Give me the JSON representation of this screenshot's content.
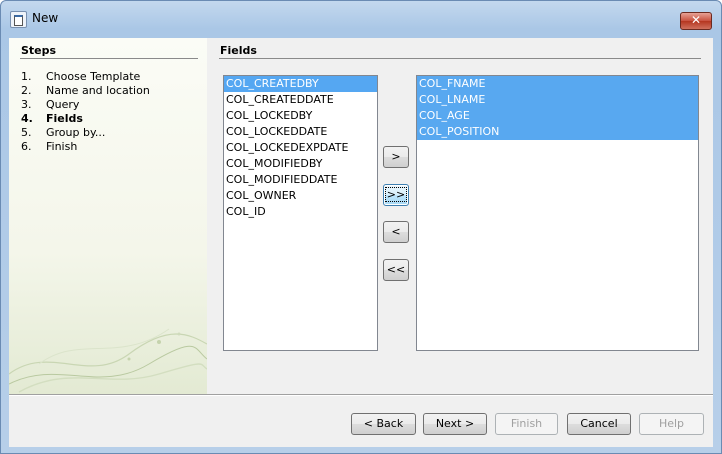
{
  "window": {
    "title": "New",
    "close_label": "✕"
  },
  "steps": {
    "title": "Steps",
    "items": [
      {
        "num": "1.",
        "label": "Choose Template"
      },
      {
        "num": "2.",
        "label": "Name and location"
      },
      {
        "num": "3.",
        "label": "Query"
      },
      {
        "num": "4.",
        "label": "Fields"
      },
      {
        "num": "5.",
        "label": "Group by..."
      },
      {
        "num": "6.",
        "label": "Finish"
      }
    ]
  },
  "fields": {
    "title": "Fields",
    "available": [
      "COL_CREATEDBY",
      "COL_CREATEDDATE",
      "COL_LOCKEDBY",
      "COL_LOCKEDDATE",
      "COL_LOCKEDEXPDATE",
      "COL_MODIFIEDBY",
      "COL_MODIFIEDDATE",
      "COL_OWNER",
      "COL_ID"
    ],
    "selected": [
      "COL_FNAME",
      "COL_LNAME",
      "COL_AGE",
      "COL_POSITION"
    ],
    "move_buttons": {
      "add": ">",
      "add_all": ">>",
      "remove": "<",
      "remove_all": "<<"
    }
  },
  "buttons": {
    "back": "< Back",
    "next": "Next >",
    "finish": "Finish",
    "cancel": "Cancel",
    "help": "Help"
  }
}
